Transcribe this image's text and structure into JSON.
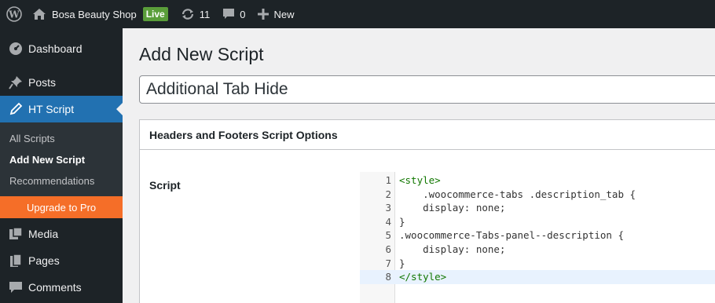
{
  "adminbar": {
    "site_name": "Bosa Beauty Shop",
    "live_badge": "Live",
    "updates_count": "11",
    "comments_count": "0",
    "new_label": "New"
  },
  "sidebar": {
    "dashboard": "Dashboard",
    "posts": "Posts",
    "ht_script": "HT Script",
    "submenu": {
      "all_scripts": "All Scripts",
      "add_new_script": "Add New Script",
      "recommendations": "Recommendations"
    },
    "upgrade": "Upgrade to Pro",
    "media": "Media",
    "pages": "Pages",
    "comments": "Comments"
  },
  "main": {
    "page_title": "Add New Script",
    "title_value": "Additional Tab Hide",
    "box_title": "Headers and Footers Script Options",
    "script_label": "Script"
  },
  "code": {
    "lines": [
      {
        "n": "1",
        "text": "<style>"
      },
      {
        "n": "2",
        "text": "    .woocommerce-tabs .description_tab {"
      },
      {
        "n": "3",
        "text": "    display: none;"
      },
      {
        "n": "4",
        "text": "}"
      },
      {
        "n": "5",
        "text": ".woocommerce-Tabs-panel--description {"
      },
      {
        "n": "6",
        "text": "    display: none;"
      },
      {
        "n": "7",
        "text": "}"
      },
      {
        "n": "8",
        "text": "</style>"
      }
    ]
  },
  "colors": {
    "admin_bg": "#1d2327",
    "accent": "#2271b1",
    "upgrade": "#f56e28"
  }
}
